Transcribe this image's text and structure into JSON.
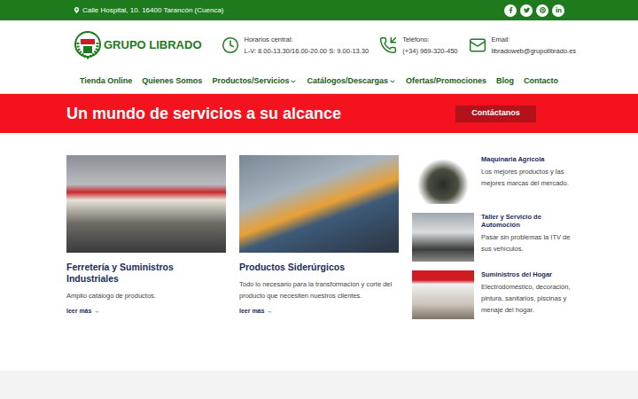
{
  "top_bar": {
    "address": "Calle Hospital, 10. 16400 Tarancón (Cuenca)"
  },
  "logo": {
    "text": "GRUPO LIBRADO"
  },
  "contact": [
    {
      "kind": "hours",
      "label": "Horarios central:",
      "value": "L-V: 8.00-13.30/16.00-20.00 S: 9.00-13.30"
    },
    {
      "kind": "phone",
      "label": "Teléfono:",
      "value": "(+34) 969-320-450"
    },
    {
      "kind": "email",
      "label": "Email:",
      "value": "libradoweb@grupolibrado.es"
    }
  ],
  "nav": [
    {
      "label": "Tienda Online",
      "dropdown": false
    },
    {
      "label": "Quienes Somos",
      "dropdown": false
    },
    {
      "label": "Productos/Servicios",
      "dropdown": true
    },
    {
      "label": "Catálogos/Descargas",
      "dropdown": true
    },
    {
      "label": "Ofertas/Promociones",
      "dropdown": false
    },
    {
      "label": "Blog",
      "dropdown": false
    },
    {
      "label": "Contacto",
      "dropdown": false
    }
  ],
  "banner": {
    "title": "Un mundo de servicios a su alcance",
    "button": "Contáctanos"
  },
  "featured": [
    {
      "title": "Ferretería y Suministros Industriales",
      "description": "Amplio catálogo de productos.",
      "link": "leer más →"
    },
    {
      "title": "Productos Siderúrgicos",
      "description": "Todo lo necesario para la transformación y corte del producto que necesiten nuestros clientes.",
      "link": "leer más →"
    }
  ],
  "services": [
    {
      "title": "Maquinaria Agrícola",
      "description": "Los mejores productos y las mejores marcas del mercado."
    },
    {
      "title": "Taller y Servicio de Automoción",
      "description": "Pasar sin problemas la ITV de sus vehículos."
    },
    {
      "title": "Suministros del Hogar",
      "description": "Electrodoméstico, decoración, pintura, sanitarios, piscinas y menaje del hogar."
    }
  ]
}
